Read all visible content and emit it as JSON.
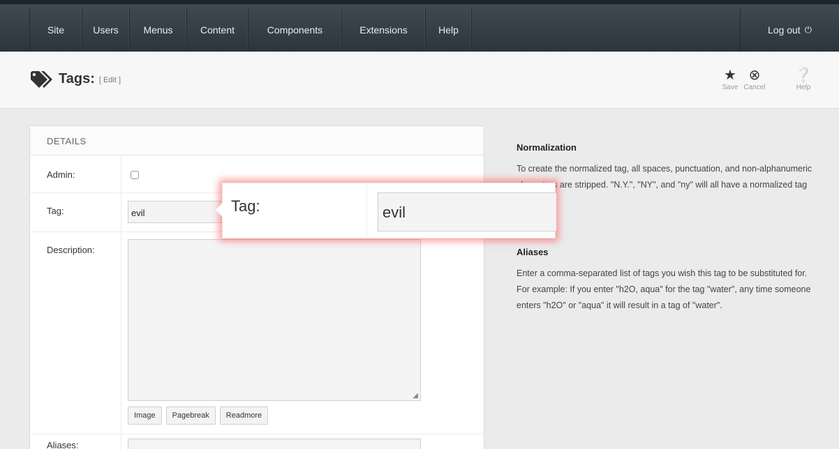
{
  "nav": {
    "items": [
      "Site",
      "Users",
      "Menus",
      "Content",
      "Components",
      "Extensions",
      "Help"
    ],
    "logout_label": "Log out"
  },
  "header": {
    "title": "Tags:",
    "subtitle": "[ Edit ]",
    "toolbar": {
      "save_label": "Save",
      "cancel_label": "Cancel",
      "help_label": "Help"
    }
  },
  "details": {
    "heading": "DETAILS",
    "admin_label": "Admin:",
    "admin_checked": false,
    "tag_label": "Tag:",
    "tag_value": "evil",
    "description_label": "Description:",
    "editor_buttons": [
      "Image",
      "Pagebreak",
      "Readmore"
    ],
    "aliases_label": "Aliases:"
  },
  "callout": {
    "label": "Tag:",
    "value": "evil"
  },
  "help": {
    "normalization_title": "Normalization",
    "normalization_text": "To create the normalized tag, all spaces, punctuation, and non-alphanumeric characters are stripped. \"N.Y.\", \"NY\", and \"ny\" will all have a normalized tag of \"ny\".",
    "aliases_title": "Aliases",
    "aliases_text": "Enter a comma-separated list of tags you wish this tag to be substituted for. For example: If you enter \"h2O, aqua\" for the tag \"water\", any time someone enters \"h2O\" or \"aqua\" it will result in a tag of \"water\"."
  },
  "colors": {
    "accent_glow": "#ff4646",
    "nav_bg": "#3a444c"
  }
}
